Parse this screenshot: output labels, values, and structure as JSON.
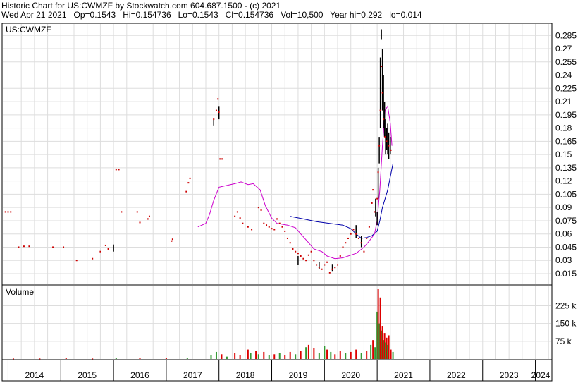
{
  "header": {
    "line1": "Historic Chart for US:CWMZF by Stockwatch.com 604.687.1500 - (c) 2021",
    "line2": "Wed Apr 21 2021   Op=0.1543   Hi=0.154736   Lo=0.1543   Cl=0.154736   Vol=10,500   Year hi=0.292   lo=0.014"
  },
  "chart_data": {
    "type": "line",
    "symbol_label": "US:CWMZF",
    "volume_label": "Volume",
    "x_ticks": [
      "2014",
      "2015",
      "2016",
      "2017",
      "2018",
      "2019",
      "2020",
      "2021",
      "2022",
      "2023",
      "2024"
    ],
    "y_ticks": [
      0.285,
      0.27,
      0.255,
      0.24,
      0.225,
      0.21,
      0.195,
      0.18,
      0.165,
      0.15,
      0.135,
      0.12,
      0.105,
      0.09,
      0.075,
      0.06,
      0.045,
      0.03,
      0.015
    ],
    "y_tick_labels": [
      "0.285",
      "0.27",
      "0.255",
      "0.24",
      "0.225",
      "0.21",
      "0.195",
      "0.18",
      "0.165",
      "0.15",
      "0.135",
      "0.12",
      "0.105",
      "0.09",
      "0.075",
      "0.06",
      "0.045",
      "0.03",
      "0.015"
    ],
    "ylim": [
      0.003,
      0.298
    ],
    "volume_ticks": [
      225000,
      150000,
      75000
    ],
    "volume_tick_labels": [
      "225 k",
      "150 k",
      "75 k"
    ],
    "volume_ylim": [
      0,
      310000
    ],
    "xlim": [
      2013.9,
      2024.3
    ],
    "colors": {
      "price": "#cc0000",
      "bar": "#000000",
      "ma_short": "#cc00cc",
      "ma_long": "#0000aa",
      "vol_up": "#339933",
      "vol_down": "#dd0000",
      "grid": "#dddddd"
    },
    "price_points": [
      [
        2013.95,
        0.085
      ],
      [
        2014.0,
        0.085
      ],
      [
        2014.05,
        0.085
      ],
      [
        2014.2,
        0.045
      ],
      [
        2014.3,
        0.046
      ],
      [
        2014.4,
        0.046
      ],
      [
        2014.85,
        0.045
      ],
      [
        2015.05,
        0.045
      ],
      [
        2015.3,
        0.03
      ],
      [
        2015.6,
        0.032
      ],
      [
        2015.75,
        0.04
      ],
      [
        2015.85,
        0.047
      ],
      [
        2015.9,
        0.043
      ],
      [
        2016.05,
        0.133
      ],
      [
        2016.1,
        0.133
      ],
      [
        2016.15,
        0.085
      ],
      [
        2016.45,
        0.085
      ],
      [
        2016.5,
        0.073
      ],
      [
        2016.65,
        0.077
      ],
      [
        2016.68,
        0.08
      ],
      [
        2017.1,
        0.052
      ],
      [
        2017.12,
        0.054
      ],
      [
        2017.38,
        0.108
      ],
      [
        2017.42,
        0.118
      ],
      [
        2017.45,
        0.123
      ],
      [
        2017.9,
        0.19
      ],
      [
        2017.95,
        0.2
      ],
      [
        2017.98,
        0.213
      ],
      [
        2018.0,
        0.198
      ],
      [
        2018.02,
        0.145
      ],
      [
        2018.06,
        0.145
      ],
      [
        2018.3,
        0.08
      ],
      [
        2018.35,
        0.085
      ],
      [
        2018.4,
        0.078
      ],
      [
        2018.45,
        0.072
      ],
      [
        2018.55,
        0.068
      ],
      [
        2018.62,
        0.065
      ],
      [
        2018.75,
        0.09
      ],
      [
        2018.8,
        0.087
      ],
      [
        2018.85,
        0.072
      ],
      [
        2018.9,
        0.07
      ],
      [
        2018.95,
        0.068
      ],
      [
        2019.0,
        0.066
      ],
      [
        2019.05,
        0.065
      ],
      [
        2019.1,
        0.077
      ],
      [
        2019.15,
        0.072
      ],
      [
        2019.2,
        0.068
      ],
      [
        2019.25,
        0.063
      ],
      [
        2019.3,
        0.055
      ],
      [
        2019.35,
        0.05
      ],
      [
        2019.4,
        0.043
      ],
      [
        2019.45,
        0.04
      ],
      [
        2019.5,
        0.038
      ],
      [
        2019.55,
        0.035
      ],
      [
        2019.6,
        0.032
      ],
      [
        2019.65,
        0.03
      ],
      [
        2019.7,
        0.036
      ],
      [
        2019.75,
        0.04
      ],
      [
        2019.8,
        0.03
      ],
      [
        2019.85,
        0.025
      ],
      [
        2019.9,
        0.022
      ],
      [
        2019.95,
        0.02
      ],
      [
        2020.0,
        0.025
      ],
      [
        2020.05,
        0.028
      ],
      [
        2020.1,
        0.016
      ],
      [
        2020.15,
        0.02
      ],
      [
        2020.2,
        0.022
      ],
      [
        2020.25,
        0.025
      ],
      [
        2020.3,
        0.035
      ],
      [
        2020.35,
        0.045
      ],
      [
        2020.4,
        0.05
      ],
      [
        2020.45,
        0.055
      ],
      [
        2020.5,
        0.06
      ],
      [
        2020.55,
        0.065
      ],
      [
        2020.6,
        0.06
      ],
      [
        2020.65,
        0.055
      ],
      [
        2020.7,
        0.05
      ],
      [
        2020.75,
        0.04
      ],
      [
        2020.8,
        0.055
      ],
      [
        2020.85,
        0.068
      ],
      [
        2020.9,
        0.095
      ],
      [
        2020.92,
        0.11
      ],
      [
        2020.95,
        0.085
      ],
      [
        2021.0,
        0.1
      ],
      [
        2021.02,
        0.13
      ],
      [
        2021.04,
        0.16
      ],
      [
        2021.06,
        0.2
      ],
      [
        2021.08,
        0.25
      ],
      [
        2021.1,
        0.22
      ],
      [
        2021.12,
        0.19
      ],
      [
        2021.15,
        0.17
      ],
      [
        2021.18,
        0.165
      ],
      [
        2021.22,
        0.16
      ],
      [
        2021.26,
        0.155
      ]
    ],
    "hl_bars": [
      [
        2017.9,
        0.183,
        0.19
      ],
      [
        2018.0,
        0.19,
        0.205
      ],
      [
        2016.0,
        0.04,
        0.048
      ],
      [
        2019.5,
        0.025,
        0.035
      ],
      [
        2019.9,
        0.02,
        0.028
      ],
      [
        2020.15,
        0.018,
        0.026
      ],
      [
        2020.6,
        0.055,
        0.07
      ],
      [
        2020.7,
        0.045,
        0.058
      ],
      [
        2020.97,
        0.08,
        0.1
      ],
      [
        2021.0,
        0.07,
        0.085
      ],
      [
        2021.02,
        0.1,
        0.135
      ],
      [
        2021.04,
        0.14,
        0.17
      ],
      [
        2021.06,
        0.18,
        0.26
      ],
      [
        2021.08,
        0.28,
        0.292
      ],
      [
        2021.1,
        0.2,
        0.27
      ],
      [
        2021.12,
        0.18,
        0.24
      ],
      [
        2021.14,
        0.17,
        0.21
      ],
      [
        2021.16,
        0.15,
        0.19
      ],
      [
        2021.18,
        0.155,
        0.18
      ],
      [
        2021.2,
        0.15,
        0.185
      ],
      [
        2021.22,
        0.145,
        0.175
      ],
      [
        2021.25,
        0.15,
        0.17
      ]
    ],
    "ma_short": [
      [
        2017.6,
        0.068
      ],
      [
        2017.75,
        0.072
      ],
      [
        2017.82,
        0.082
      ],
      [
        2017.9,
        0.098
      ],
      [
        2018.0,
        0.113
      ],
      [
        2018.15,
        0.115
      ],
      [
        2018.3,
        0.117
      ],
      [
        2018.42,
        0.119
      ],
      [
        2018.55,
        0.116
      ],
      [
        2018.65,
        0.117
      ],
      [
        2018.78,
        0.11
      ],
      [
        2018.88,
        0.092
      ],
      [
        2019.0,
        0.078
      ],
      [
        2019.1,
        0.072
      ],
      [
        2019.3,
        0.07
      ],
      [
        2019.45,
        0.067
      ],
      [
        2019.55,
        0.06
      ],
      [
        2019.7,
        0.05
      ],
      [
        2019.8,
        0.043
      ],
      [
        2019.95,
        0.04
      ],
      [
        2020.05,
        0.035
      ],
      [
        2020.2,
        0.032
      ],
      [
        2020.35,
        0.033
      ],
      [
        2020.5,
        0.036
      ],
      [
        2020.6,
        0.038
      ],
      [
        2020.75,
        0.045
      ],
      [
        2020.85,
        0.052
      ],
      [
        2020.95,
        0.06
      ],
      [
        2021.0,
        0.075
      ],
      [
        2021.05,
        0.11
      ],
      [
        2021.1,
        0.16
      ],
      [
        2021.15,
        0.2
      ],
      [
        2021.2,
        0.205
      ],
      [
        2021.25,
        0.185
      ],
      [
        2021.28,
        0.16
      ]
    ],
    "ma_long": [
      [
        2019.35,
        0.08
      ],
      [
        2019.6,
        0.077
      ],
      [
        2019.85,
        0.074
      ],
      [
        2020.1,
        0.072
      ],
      [
        2020.35,
        0.07
      ],
      [
        2020.5,
        0.066
      ],
      [
        2020.6,
        0.06
      ],
      [
        2020.7,
        0.055
      ],
      [
        2020.8,
        0.056
      ],
      [
        2020.9,
        0.058
      ],
      [
        2021.0,
        0.063
      ],
      [
        2021.05,
        0.075
      ],
      [
        2021.1,
        0.09
      ],
      [
        2021.15,
        0.1
      ],
      [
        2021.2,
        0.11
      ],
      [
        2021.25,
        0.125
      ],
      [
        2021.3,
        0.14
      ]
    ],
    "volume_bars": [
      [
        2014.1,
        2000,
        "d"
      ],
      [
        2014.6,
        2000,
        "d"
      ],
      [
        2015.1,
        3000,
        "d"
      ],
      [
        2015.6,
        2000,
        "d"
      ],
      [
        2016.05,
        4000,
        "u"
      ],
      [
        2016.5,
        3000,
        "d"
      ],
      [
        2017.0,
        4000,
        "d"
      ],
      [
        2017.4,
        5000,
        "u"
      ],
      [
        2017.85,
        15000,
        "u"
      ],
      [
        2017.95,
        30000,
        "u"
      ],
      [
        2018.05,
        20000,
        "d"
      ],
      [
        2018.15,
        10000,
        "u"
      ],
      [
        2018.3,
        25000,
        "d"
      ],
      [
        2018.4,
        15000,
        "d"
      ],
      [
        2018.55,
        40000,
        "d"
      ],
      [
        2018.6,
        25000,
        "u"
      ],
      [
        2018.7,
        35000,
        "d"
      ],
      [
        2018.75,
        20000,
        "u"
      ],
      [
        2018.85,
        30000,
        "d"
      ],
      [
        2018.95,
        15000,
        "u"
      ],
      [
        2019.05,
        20000,
        "d"
      ],
      [
        2019.15,
        25000,
        "u"
      ],
      [
        2019.25,
        15000,
        "d"
      ],
      [
        2019.35,
        30000,
        "d"
      ],
      [
        2019.45,
        20000,
        "u"
      ],
      [
        2019.55,
        35000,
        "d"
      ],
      [
        2019.65,
        50000,
        "u"
      ],
      [
        2019.7,
        60000,
        "d"
      ],
      [
        2019.8,
        45000,
        "d"
      ],
      [
        2019.9,
        25000,
        "u"
      ],
      [
        2020.0,
        55000,
        "u"
      ],
      [
        2020.05,
        40000,
        "d"
      ],
      [
        2020.12,
        30000,
        "u"
      ],
      [
        2020.2,
        20000,
        "d"
      ],
      [
        2020.3,
        35000,
        "d"
      ],
      [
        2020.4,
        25000,
        "u"
      ],
      [
        2020.5,
        30000,
        "d"
      ],
      [
        2020.6,
        40000,
        "d"
      ],
      [
        2020.7,
        25000,
        "u"
      ],
      [
        2020.8,
        35000,
        "d"
      ],
      [
        2020.88,
        60000,
        "u"
      ],
      [
        2020.92,
        80000,
        "d"
      ],
      [
        2020.96,
        50000,
        "u"
      ],
      [
        2021.0,
        200000,
        "u"
      ],
      [
        2021.02,
        295000,
        "d"
      ],
      [
        2021.04,
        150000,
        "u"
      ],
      [
        2021.06,
        260000,
        "d"
      ],
      [
        2021.08,
        120000,
        "u"
      ],
      [
        2021.1,
        140000,
        "d"
      ],
      [
        2021.12,
        80000,
        "u"
      ],
      [
        2021.14,
        110000,
        "d"
      ],
      [
        2021.16,
        70000,
        "u"
      ],
      [
        2021.18,
        90000,
        "d"
      ],
      [
        2021.2,
        60000,
        "u"
      ],
      [
        2021.22,
        100000,
        "d"
      ],
      [
        2021.26,
        40000,
        "d"
      ],
      [
        2021.3,
        30000,
        "u"
      ]
    ]
  }
}
